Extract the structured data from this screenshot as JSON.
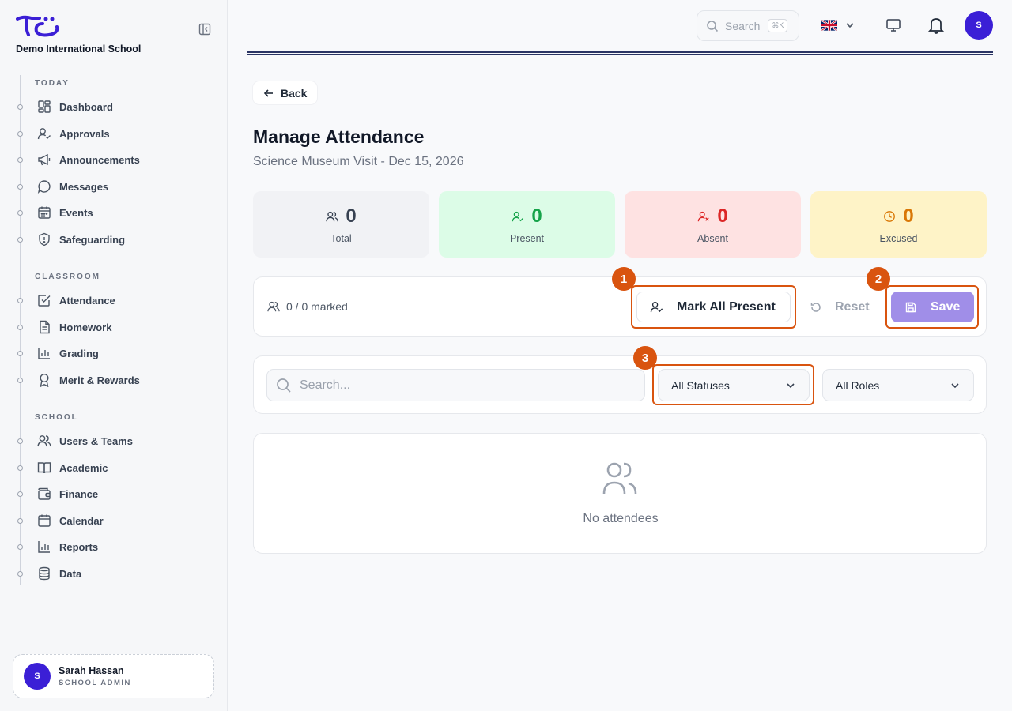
{
  "app": {
    "school_name": "Demo International School"
  },
  "sidebar": {
    "sections": [
      {
        "title": "TODAY"
      },
      {
        "title": "CLASSROOM"
      },
      {
        "title": "SCHOOL"
      }
    ],
    "items": [
      {
        "label": "Dashboard",
        "icon": "dashboard-icon"
      },
      {
        "label": "Approvals",
        "icon": "user-check-icon"
      },
      {
        "label": "Announcements",
        "icon": "megaphone-icon"
      },
      {
        "label": "Messages",
        "icon": "chat-bubble-icon"
      },
      {
        "label": "Events",
        "icon": "calendar-grid-icon"
      },
      {
        "label": "Safeguarding",
        "icon": "shield-icon"
      },
      {
        "label": "Attendance",
        "icon": "checkbox-icon"
      },
      {
        "label": "Homework",
        "icon": "document-icon"
      },
      {
        "label": "Grading",
        "icon": "bar-chart-icon"
      },
      {
        "label": "Merit & Rewards",
        "icon": "award-icon"
      },
      {
        "label": "Users & Teams",
        "icon": "users-icon"
      },
      {
        "label": "Academic",
        "icon": "book-icon"
      },
      {
        "label": "Finance",
        "icon": "wallet-icon"
      },
      {
        "label": "Calendar",
        "icon": "calendar-icon"
      },
      {
        "label": "Reports",
        "icon": "bar-chart-icon"
      },
      {
        "label": "Data",
        "icon": "database-icon"
      }
    ],
    "user": {
      "initial": "S",
      "name": "Sarah Hassan",
      "role": "SCHOOL ADMIN"
    }
  },
  "topbar": {
    "search_label": "Search",
    "search_shortcut": "⌘K",
    "avatar_initial": "S"
  },
  "main": {
    "back_label": "Back",
    "title": "Manage Attendance",
    "subtitle": "Science Museum Visit - Dec 15, 2026",
    "stats": [
      {
        "label": "Total",
        "value": "0",
        "color": "#374151",
        "bg": "#f1f2f5"
      },
      {
        "label": "Present",
        "value": "0",
        "color": "#16a34a",
        "bg": "#dcfce7"
      },
      {
        "label": "Absent",
        "value": "0",
        "color": "#dc2626",
        "bg": "#fee2e2"
      },
      {
        "label": "Excused",
        "value": "0",
        "color": "#d97706",
        "bg": "#fef3c7"
      }
    ],
    "toolbar": {
      "marked_text": "0 / 0 marked",
      "mark_all_label": "Mark All Present",
      "reset_label": "Reset",
      "save_label": "Save"
    },
    "filters": {
      "search_placeholder": "Search...",
      "status_selected": "All Statuses",
      "role_selected": "All Roles"
    },
    "empty_text": "No attendees"
  },
  "annotations": [
    {
      "number": "1"
    },
    {
      "number": "2"
    },
    {
      "number": "3"
    }
  ],
  "colors": {
    "accent": "#3b1fd6",
    "highlight": "#d9540f",
    "save_button": "#a08ee8"
  }
}
